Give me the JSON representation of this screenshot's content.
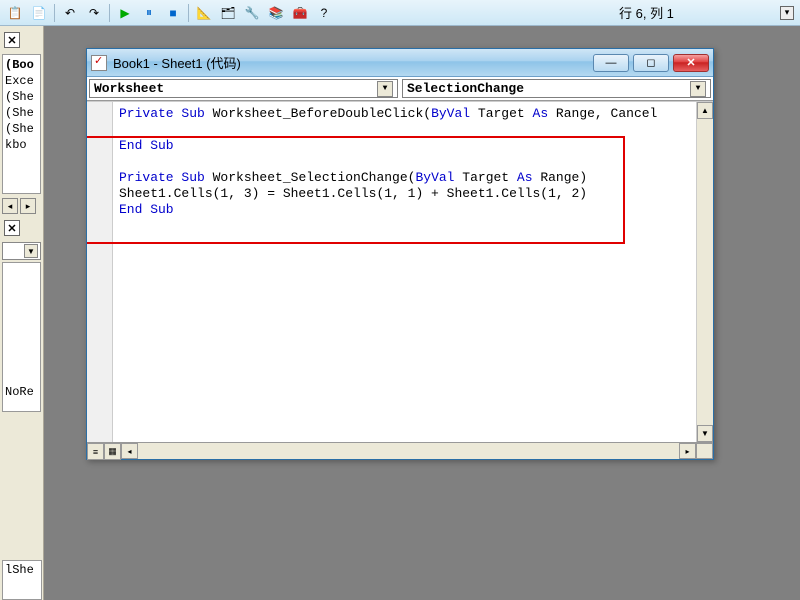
{
  "toolbar": {
    "status": "行 6, 列 1"
  },
  "left": {
    "project_items": [
      "(Boo",
      "Exce",
      "(She",
      "(She",
      "(She",
      "kbo"
    ],
    "prop_item": "NoRe",
    "bottom_item": "lShe"
  },
  "codewin": {
    "title": "Book1 - Sheet1 (代码)",
    "combo_object": "Worksheet",
    "combo_proc": "SelectionChange",
    "code": {
      "line1_pre": "Private Sub",
      "line1_rest": " Worksheet_BeforeDoubleClick(",
      "line1_byval": "ByVal",
      "line1_mid": " Target ",
      "line1_as": "As",
      "line1_end": " Range, Cancel ",
      "line2": "",
      "line3": "End Sub",
      "line4": "",
      "line5_pre": "Private Sub",
      "line5_rest": " Worksheet_SelectionChange(",
      "line5_byval": "ByVal",
      "line5_mid": " Target ",
      "line5_as": "As",
      "line5_end": " Range)",
      "line6": "Sheet1.Cells(1, 3) = Sheet1.Cells(1, 1) + Sheet1.Cells(1, 2)",
      "line7": "End Sub"
    }
  }
}
